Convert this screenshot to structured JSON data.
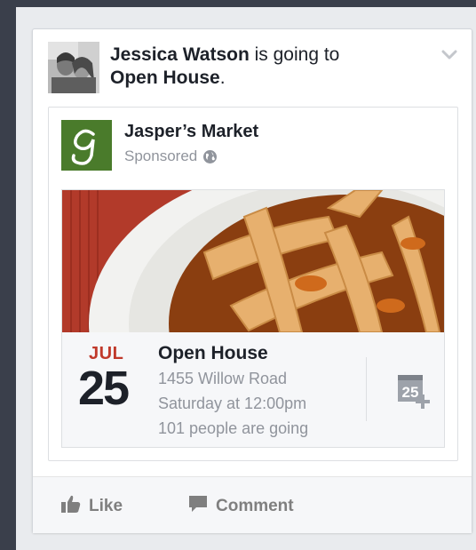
{
  "story": {
    "author": "Jessica Watson",
    "verb": " is going to",
    "event_link": "Open House",
    "period": "."
  },
  "ad": {
    "page_name": "Jasper’s Market",
    "sponsored_label": "Sponsored",
    "logo_letter": "g"
  },
  "event": {
    "month": "JUL",
    "day": "25",
    "title": "Open House",
    "address": "1455 Willow Road",
    "time": "Saturday at 12:00pm",
    "attendance": "101 people are going",
    "calendar_day": "25"
  },
  "actions": {
    "like_label": "Like",
    "comment_label": "Comment"
  },
  "colors": {
    "month_red": "#c0392b",
    "logo_green": "#4a7b2b",
    "muted_text": "#90949c"
  }
}
